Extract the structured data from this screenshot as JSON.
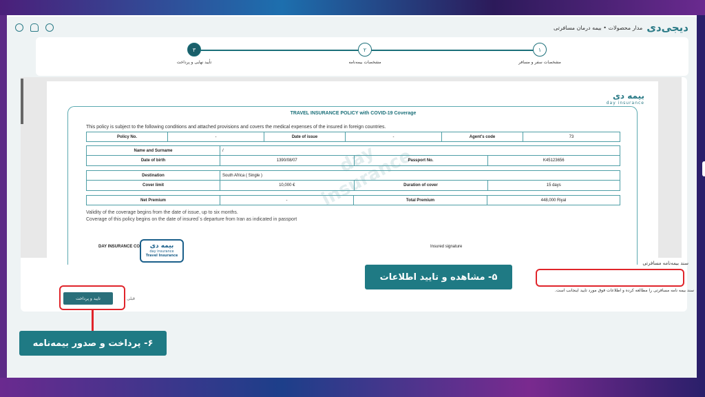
{
  "header": {
    "brand": "دیجی‌دی",
    "breadcrumb": "مدار محصولات • بیمه درمان مسافرتی"
  },
  "stepper": {
    "steps": [
      {
        "number": "۱",
        "label": "مشخصات سفر و مسافر"
      },
      {
        "number": "۲",
        "label": "مشخصات بیمه‌نامه"
      },
      {
        "number": "۳",
        "label": "تأیید نهایی و پرداخت"
      }
    ]
  },
  "document": {
    "logo": "بیمه دی",
    "logo_sub": "day insurance",
    "title": "TRAVEL INSURANCE POLICY with COVID-19 Coverage",
    "intro": "This policy is subject to the following conditions and attached provisions and covers the medical expenses of the insured in foreign countries.",
    "row1": {
      "policy_no_label": "Policy No.",
      "policy_no": "-",
      "issue_label": "Date of issue",
      "issue": "-",
      "agent_label": "Agent's code",
      "agent": "73"
    },
    "name": {
      "label": "Name and Surname",
      "value": "/"
    },
    "birth": {
      "label": "Date of birth",
      "value": "1390/08/07",
      "passport_label": "Passport No.",
      "passport": "K45123656"
    },
    "destination": {
      "label": "Destination",
      "value": "South Africa ( Single )"
    },
    "cover": {
      "label": "Cover limit",
      "value": "10,000 €",
      "duration_label": "Duration of cover",
      "duration": "15 days"
    },
    "premium": {
      "label": "Net Premium",
      "value": "-",
      "total_label": "Total Premium",
      "total": "448,000 Riyal"
    },
    "note1": "Validity of the coverage begins from the date of issue, up to six months.",
    "note2": "Coverage of this policy begins on the date of insured`s departure from Iran as indicated in passport",
    "company": "DAY INSURANCE CO.",
    "signature": "Insured signature",
    "stamp_mark": "بیمه دی",
    "stamp_sub": "day insurance",
    "stamp_sub2": "Travel Insurance",
    "watermark": "day insurance"
  },
  "confirm": {
    "checkbox_label": "سند بیمه‌نامه مسافرتی",
    "text": "سند بیمه نامه مسافرتی را مطالعه کرده و اطلاعات فوق مورد تایید اینجانب است."
  },
  "buttons": {
    "pay": "تایید و پرداخت",
    "prev": "قبلی"
  },
  "callouts": {
    "step5": "۵- مشاهده و تایید اطلاعات",
    "step6": "۶- پرداخت و صدور بیمه‌نامه"
  },
  "colors": {
    "accent": "#1f7a84",
    "highlight": "#e0242a"
  }
}
